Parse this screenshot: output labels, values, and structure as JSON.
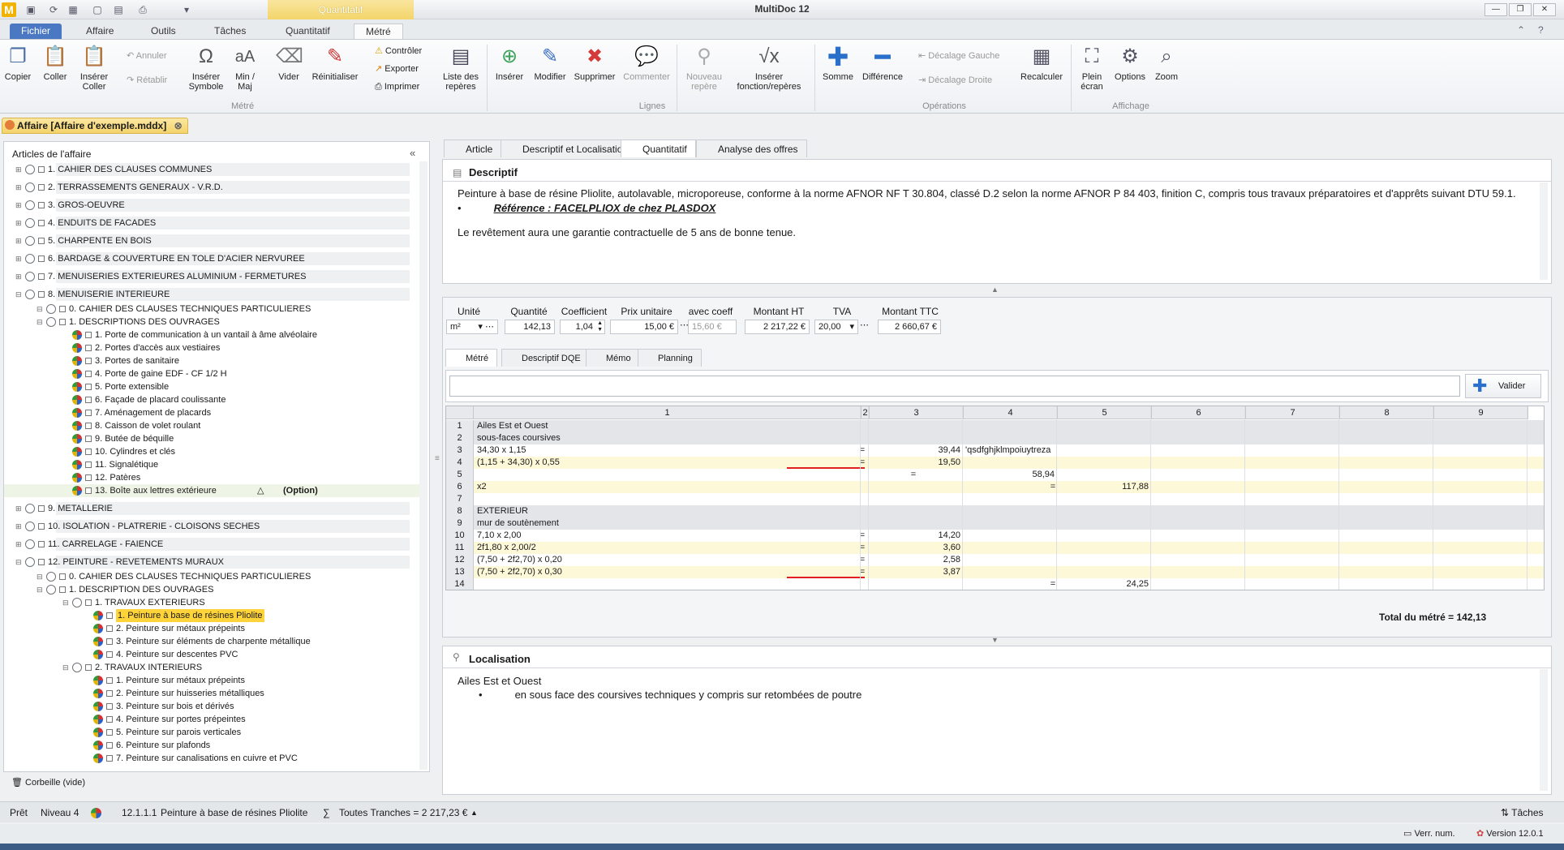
{
  "app": {
    "title": "MultiDoc 12",
    "context_tab": "Quantitatif",
    "logo": "M"
  },
  "menu_tabs": [
    "Fichier",
    "Affaire",
    "Outils",
    "Tâches",
    "Quantitatif",
    "Métré"
  ],
  "ribbon": {
    "copier": "Copier",
    "coller": "Coller",
    "inserer_coller": "Insérer\nColler",
    "annuler": "Annuler",
    "retablir": "Rétablir",
    "inserer_symbole": "Insérer\nSymbole",
    "min_maj": "Min /\nMaj",
    "vider": "Vider",
    "reinitialiser": "Réinitialiser",
    "controler": "Contrôler",
    "exporter": "Exporter",
    "imprimer": "Imprimer",
    "liste_reperes": "Liste des\nrepères",
    "inserer": "Insérer",
    "modifier": "Modifier",
    "supprimer": "Supprimer",
    "commenter": "Commenter",
    "nouveau_repere": "Nouveau\nrepère",
    "inserer_fonction": "Insérer\nfonction/repères",
    "somme": "Somme",
    "difference": "Différence",
    "decalage_gauche": "Décalage Gauche",
    "decalage_droite": "Décalage Droite",
    "recalculer": "Recalculer",
    "plein_ecran": "Plein\nécran",
    "options": "Options",
    "zoom": "Zoom",
    "group_metre": "Métré",
    "group_lignes": "Lignes",
    "group_operations": "Opérations",
    "group_affichage": "Affichage"
  },
  "doc_tab": "Affaire [Affaire d'exemple.mddx]",
  "left": {
    "title": "Articles de l'affaire",
    "tree": [
      {
        "t": "1. CAHIER DES CLAUSES COMMUNES",
        "lvl": 0,
        "top": true
      },
      {
        "t": "2. TERRASSEMENTS GENERAUX - V.R.D.",
        "lvl": 0,
        "top": true
      },
      {
        "t": "3. GROS-OEUVRE",
        "lvl": 0,
        "top": true
      },
      {
        "t": "4. ENDUITS DE FACADES",
        "lvl": 0,
        "top": true
      },
      {
        "t": "5. CHARPENTE EN BOIS",
        "lvl": 0,
        "top": true
      },
      {
        "t": "6. BARDAGE & COUVERTURE EN TOLE D'ACIER NERVUREE",
        "lvl": 0,
        "top": true
      },
      {
        "t": "7. MENUISERIES EXTERIEURES ALUMINIUM - FERMETURES",
        "lvl": 0,
        "top": true
      },
      {
        "t": "8. MENUISERIE INTERIEURE",
        "lvl": 0,
        "top": true
      },
      {
        "t": "0. CAHIER DES CLAUSES TECHNIQUES PARTICULIERES",
        "lvl": 1
      },
      {
        "t": "1. DESCRIPTIONS DES OUVRAGES",
        "lvl": 1
      },
      {
        "t": "1. Porte de communication à un vantail à âme alvéolaire",
        "lvl": 2,
        "pie": true
      },
      {
        "t": "2. Portes d'accès aux vestiaires",
        "lvl": 2,
        "pie": true
      },
      {
        "t": "3. Portes de sanitaire",
        "lvl": 2,
        "pie": true
      },
      {
        "t": "4. Porte de gaine EDF - CF 1/2 H",
        "lvl": 2,
        "pie": true
      },
      {
        "t": "5. Porte extensible",
        "lvl": 2,
        "pie": true
      },
      {
        "t": "6. Façade de placard coulissante",
        "lvl": 2,
        "pie": true
      },
      {
        "t": "7. Aménagement de placards",
        "lvl": 2,
        "pie": true
      },
      {
        "t": "8. Caisson de volet roulant",
        "lvl": 2,
        "pie": true
      },
      {
        "t": "9. Butée de béquille",
        "lvl": 2,
        "pie": true
      },
      {
        "t": "10. Cylindres et clés",
        "lvl": 2,
        "pie": true
      },
      {
        "t": "11. Signalétique",
        "lvl": 2,
        "pie": true
      },
      {
        "t": "12. Patères",
        "lvl": 2,
        "pie": true
      },
      {
        "t": "13. Boîte aux lettres extérieure",
        "lvl": 2,
        "pie": true,
        "option": "(Option)"
      },
      {
        "t": "9. METALLERIE",
        "lvl": 0,
        "top": true
      },
      {
        "t": "10. ISOLATION - PLATRERIE - CLOISONS SECHES",
        "lvl": 0,
        "top": true
      },
      {
        "t": "11. CARRELAGE - FAIENCE",
        "lvl": 0,
        "top": true
      },
      {
        "t": "12. PEINTURE - REVETEMENTS MURAUX",
        "lvl": 0,
        "top": true
      },
      {
        "t": "0. CAHIER DES CLAUSES TECHNIQUES PARTICULIERES",
        "lvl": 1
      },
      {
        "t": "1. DESCRIPTION DES OUVRAGES",
        "lvl": 1
      },
      {
        "t": "1. TRAVAUX EXTERIEURS",
        "lvl": 2
      },
      {
        "t": "1. Peinture à base de résines Pliolite",
        "lvl": 3,
        "pie": true,
        "sel": true
      },
      {
        "t": "2. Peinture sur métaux prépeints",
        "lvl": 3,
        "pie": true
      },
      {
        "t": "3. Peinture sur éléments de charpente métallique",
        "lvl": 3,
        "pie": true
      },
      {
        "t": "4. Peinture sur descentes PVC",
        "lvl": 3,
        "pie": true
      },
      {
        "t": "2. TRAVAUX INTERIEURS",
        "lvl": 2
      },
      {
        "t": "1. Peinture sur métaux prépeints",
        "lvl": 3,
        "pie": true
      },
      {
        "t": "2. Peinture sur huisseries métalliques",
        "lvl": 3,
        "pie": true
      },
      {
        "t": "3. Peinture sur bois et dérivés",
        "lvl": 3,
        "pie": true
      },
      {
        "t": "4. Peinture sur portes prépeintes",
        "lvl": 3,
        "pie": true
      },
      {
        "t": "5. Peinture sur parois verticales",
        "lvl": 3,
        "pie": true
      },
      {
        "t": "6. Peinture sur plafonds",
        "lvl": 3,
        "pie": true
      },
      {
        "t": "7. Peinture sur canalisations en cuivre et PVC",
        "lvl": 3,
        "pie": true
      }
    ],
    "basket": "Corbeille (vide)"
  },
  "right_tabs": [
    "Article",
    "Descriptif et Localisation",
    "Quantitatif",
    "Analyse des offres"
  ],
  "descriptif": {
    "title": "Descriptif",
    "p1": "Peinture à base de résine Pliolite, autolavable, microporeuse, conforme à la norme AFNOR NF T 30.804, classé D.2 selon la norme AFNOR P 84 403, finition C, compris tous travaux préparatoires et d'apprêts suivant DTU 59.1.",
    "ref": "Référence : FACELPLIOX de chez PLASDOX",
    "p2": "Le revêtement aura une garantie contractuelle de 5 ans de bonne tenue."
  },
  "fields": {
    "labels": [
      "Unité",
      "Quantité",
      "Coefficient",
      "Prix unitaire",
      "avec coeff",
      "Montant HT",
      "TVA",
      "Montant TTC"
    ],
    "unite": "m²",
    "quantite": "142,13",
    "coefficient": "1,04",
    "prix_unitaire": "15,00 €",
    "avec_coeff": "15,60 €",
    "montant_ht": "2 217,22 €",
    "tva": "20,00",
    "montant_ttc": "2 660,67 €"
  },
  "inner_tabs": [
    "Métré",
    "Descriptif DQE",
    "Mémo",
    "Planning"
  ],
  "valider": "Valider",
  "grid": {
    "headers": [
      "1",
      "2",
      "3",
      "4",
      "5",
      "6",
      "7",
      "8",
      "9"
    ],
    "rows": [
      {
        "n": "1",
        "c1": "Ailes Est et Ouest",
        "style": "gray"
      },
      {
        "n": "2",
        "c1": "sous-faces coursives",
        "style": "gray"
      },
      {
        "n": "3",
        "c1": "34,30 x 1,15",
        "c2": "=",
        "c3": "39,44",
        "c4": "'qsdfghjklmpoiuytreza",
        "style": "white"
      },
      {
        "n": "4",
        "c1": "(1,15 + 34,30) x 0,55",
        "c2": "=",
        "c3": "19,50",
        "style": "yellow",
        "red": true
      },
      {
        "n": "5",
        "c3": "=",
        "c4r": "58,94",
        "style": "white"
      },
      {
        "n": "6",
        "c1": "x2",
        "c4eq": "=",
        "c5r": "117,88",
        "style": "yellow"
      },
      {
        "n": "7",
        "style": "white"
      },
      {
        "n": "8",
        "c1": "EXTERIEUR",
        "style": "gray"
      },
      {
        "n": "9",
        "c1": "mur de soutènement",
        "style": "gray"
      },
      {
        "n": "10",
        "c1": "7,10 x 2,00",
        "c2": "=",
        "c3": "14,20",
        "style": "white"
      },
      {
        "n": "11",
        "c1": "2f1,80 x 2,00/2",
        "c2": "=",
        "c3": "3,60",
        "style": "yellow"
      },
      {
        "n": "12",
        "c1": "(7,50 + 2f2,70) x 0,20",
        "c2": "=",
        "c3": "2,58",
        "style": "white"
      },
      {
        "n": "13",
        "c1": "(7,50 + 2f2,70) x 0,30",
        "c2": "=",
        "c3": "3,87",
        "style": "yellow",
        "red": true
      },
      {
        "n": "14",
        "c4eq": "=",
        "c5r": "24,25",
        "style": "white"
      }
    ]
  },
  "total_label": "Total du métré = ",
  "total_value": "142,13",
  "localisation": {
    "title": "Localisation",
    "line1": "Ailes Est et Ouest",
    "bullet": "en sous face des coursives techniques y compris sur retombées de poutre"
  },
  "status": {
    "pret": "Prêt",
    "niveau": "Niveau 4",
    "code": "12.1.1.1",
    "article": "Peinture à base de résines Pliolite",
    "tranches": "Toutes Tranches = 2 217,23 €",
    "taches": "Tâches",
    "verr": "Verr. num.",
    "version": "Version 12.0.1"
  }
}
